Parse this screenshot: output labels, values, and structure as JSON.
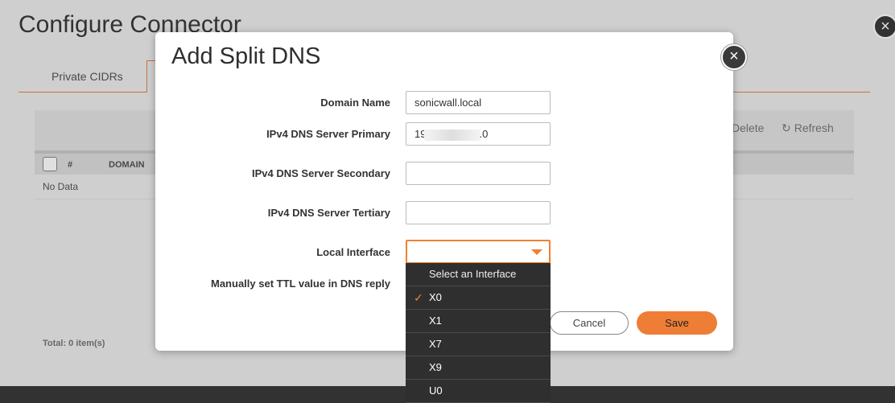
{
  "background": {
    "title": "Configure Connector",
    "tabs": [
      "Private CIDRs"
    ],
    "toolbar": {
      "delete_label": "Delete",
      "refresh_label": "Refresh"
    },
    "table": {
      "headers": [
        "#",
        "DOMAIN"
      ],
      "empty_text": "No Data"
    },
    "total": "Total: 0 item(s)"
  },
  "modal": {
    "title": "Add Split DNS",
    "fields": {
      "domain_name": {
        "label": "Domain Name",
        "value": "sonicwall.local"
      },
      "dns_primary": {
        "label": "IPv4 DNS Server Primary",
        "value_start": "19",
        "value_end": ".0"
      },
      "dns_secondary": {
        "label": "IPv4 DNS Server Secondary",
        "value": ""
      },
      "dns_tertiary": {
        "label": "IPv4 DNS Server Tertiary",
        "value": ""
      },
      "local_interface": {
        "label": "Local Interface",
        "value": ""
      },
      "ttl": {
        "label": "Manually set TTL value in DNS reply"
      }
    },
    "buttons": {
      "cancel": "Cancel",
      "save": "Save"
    }
  },
  "dropdown": {
    "placeholder": "Select an Interface",
    "options": [
      "X0",
      "X1",
      "X7",
      "X9",
      "U0"
    ],
    "selected": "X0"
  },
  "colors": {
    "accent": "#ee7d36",
    "dropdown_bg": "#2f2f2f"
  },
  "icons": {
    "close": "close-icon",
    "check": "checkmark-icon",
    "refresh": "refresh-icon",
    "caret": "caret-down-icon"
  }
}
